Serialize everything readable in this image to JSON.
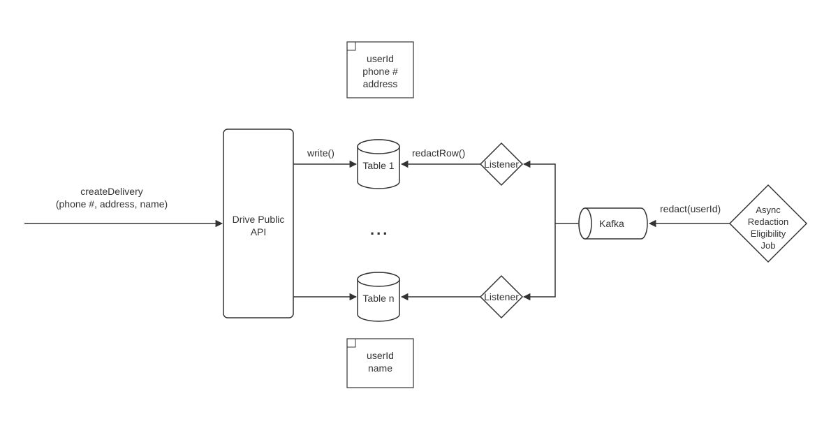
{
  "input": {
    "label": "createDelivery\n(phone #, address, name)"
  },
  "api": {
    "label": "Drive Public\nAPI"
  },
  "tables": {
    "table1": {
      "label": "Table 1",
      "note": "userId\nphone #\naddress"
    },
    "ellipsis": "...",
    "tableN": {
      "label": "Table n",
      "note": "userId\nname"
    }
  },
  "edges": {
    "write": "write()",
    "redactRow": "redactRow()",
    "redact": "redact(userId)"
  },
  "listeners": {
    "l1": "Listener",
    "lN": "Listener"
  },
  "kafka": {
    "label": "Kafka"
  },
  "job": {
    "label": "Async\nRedaction\nEligibility\nJob"
  }
}
